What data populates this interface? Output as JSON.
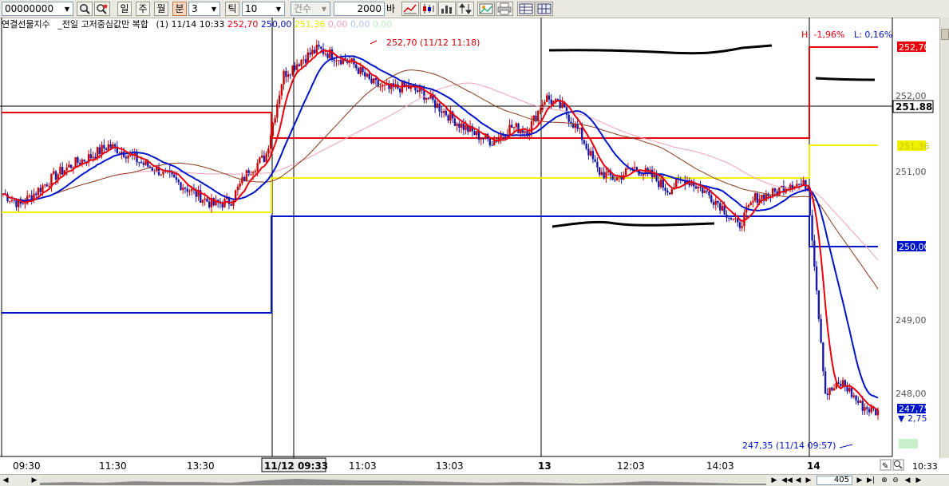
{
  "toolbar": {
    "code": "00000000",
    "period_buttons": [
      "일",
      "주",
      "월",
      "분"
    ],
    "interval": "3",
    "tick_label": "틱",
    "tick_value": "10",
    "unit_combo": "건수",
    "count_value": "2000",
    "count_suffix": "바"
  },
  "legend": {
    "title": "연결선물지수",
    "subtitle": "_전일 고저중심값만 복합",
    "info": "(1) 11/14 10:33",
    "v_red": "252,70",
    "v_blue": "250,00",
    "v_yellow": "251,36",
    "v_pink": "0,00",
    "v_lightblue": "0,00",
    "v_green": "0,00"
  },
  "chart": {
    "hl_high": "H: -1,96%",
    "hl_low": "L: 0,16%",
    "annot_high": "252,70 (11/12 11:18)",
    "annot_low": "247,35 (11/14 09:57)",
    "cursor_label": "11/12 09:33",
    "current_price": "251.88",
    "price_ticks": [
      "252,00",
      "251,00",
      "250,00",
      "249,00",
      "248,00"
    ],
    "tag_red": "252,70",
    "tag_yellow": "251,36",
    "tag_blue": "250,00",
    "tag_close": "247,75",
    "tag_change": "▼ 2,75",
    "time_ticks": [
      "09:30",
      "11:30",
      "13:30",
      "11:03",
      "13:03",
      "13",
      "12:03",
      "14:03",
      "14"
    ],
    "axis_right_time": "10:33"
  },
  "colors": {
    "candle_up": "#cc0000",
    "candle_down": "#1a1aaa",
    "ma_short": "#e8000c",
    "ma_long": "#0014c8",
    "ma_mid": "#8b3a1a",
    "ma_pink": "#f0a0b8",
    "hl_line_red": "#e8000c",
    "hl_line_blue": "#0014c8",
    "hl_line_yellow": "#f0f000"
  },
  "chart_data": {
    "type": "candlestick",
    "ylim": [
      247.2,
      253.0
    ],
    "sessions": [
      "11/12",
      "11/13",
      "11/14"
    ],
    "close_path": [
      250.7,
      250.55,
      250.75,
      250.95,
      251.1,
      251.2,
      251.35,
      251.25,
      251.1,
      251.0,
      250.85,
      250.7,
      250.55,
      250.6,
      251.0,
      251.2,
      252.3,
      252.5,
      252.65,
      252.55,
      252.45,
      252.2,
      252.1,
      252.15,
      252.05,
      251.85,
      251.65,
      251.5,
      251.4,
      251.6,
      251.55,
      252.0,
      251.85,
      251.5,
      251.0,
      250.9,
      251.05,
      250.95,
      250.75,
      250.9,
      250.75,
      250.55,
      250.25,
      250.65,
      250.7,
      250.85,
      250.8,
      248.0,
      248.15,
      247.85,
      247.75
    ],
    "prior_day_levels": {
      "high": 252.7,
      "center": 251.36,
      "low": 250.0
    }
  }
}
